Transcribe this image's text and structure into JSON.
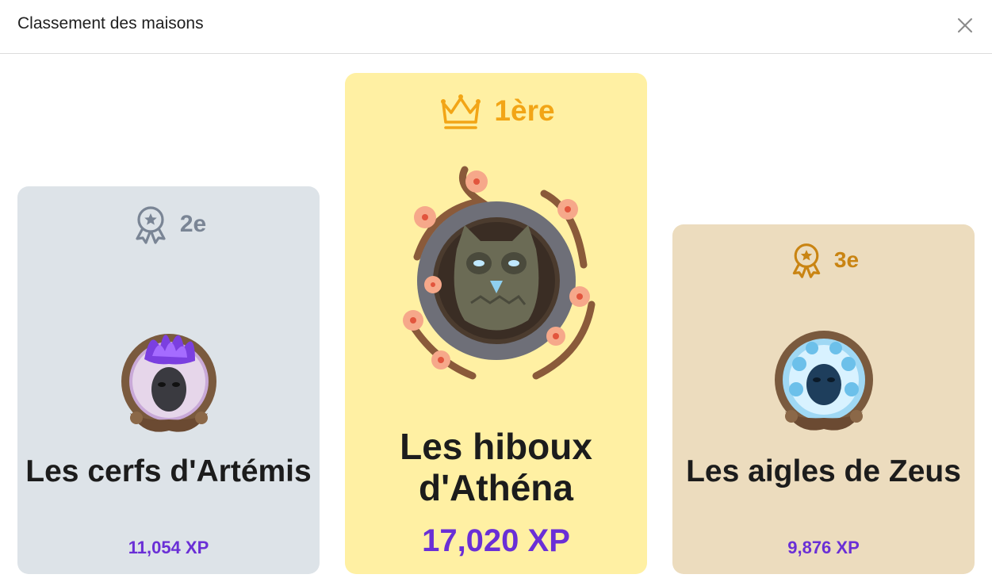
{
  "dialog": {
    "title": "Classement des maisons",
    "close_icon": "close-icon"
  },
  "podium": [
    {
      "rank_label": "2e",
      "rank_icon": "award-ribbon-icon",
      "house_name": "Les cerfs d'Artémis",
      "xp": "11,054 XP",
      "emblem": "stag-mask-emblem",
      "card_color": "#dde3e8",
      "accent_color": "#7a8595"
    },
    {
      "rank_label": "1ère",
      "rank_icon": "crown-icon",
      "house_name": "Les hiboux d'Athéna",
      "xp": "17,020 XP",
      "emblem": "owl-emblem",
      "card_color": "#fff0a3",
      "accent_color": "#f2a516"
    },
    {
      "rank_label": "3e",
      "rank_icon": "award-ribbon-icon",
      "house_name": "Les aigles de Zeus",
      "xp": "9,876 XP",
      "emblem": "eagle-mask-emblem",
      "card_color": "#ecdcbe",
      "accent_color": "#c98412"
    }
  ],
  "xp_color": "#6a2fd6"
}
